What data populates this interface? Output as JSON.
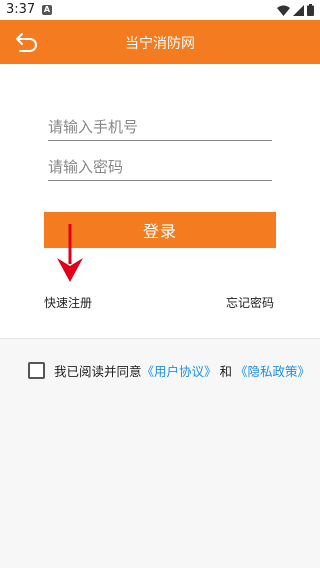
{
  "status_bar": {
    "time": "3:37",
    "notification_icon": "A",
    "icons": [
      "wifi-icon",
      "signal-icon",
      "battery-icon"
    ]
  },
  "app_bar": {
    "title": "当宁消防网",
    "back_icon": "back-arrow-icon",
    "color": "#f47b20"
  },
  "login_form": {
    "phone_placeholder": "请输入手机号",
    "password_placeholder": "请输入密码",
    "login_label": "登录",
    "register_label": "快速注册",
    "forgot_label": "忘记密码"
  },
  "agreement": {
    "prefix": "我已阅读并同意",
    "user_agreement": "《用户协议》",
    "conjunction": "和",
    "privacy_policy": "《隐私政策》",
    "checked": false,
    "link_color": "#1e90e8"
  },
  "annotation": {
    "arrow_color": "#e0001a"
  }
}
